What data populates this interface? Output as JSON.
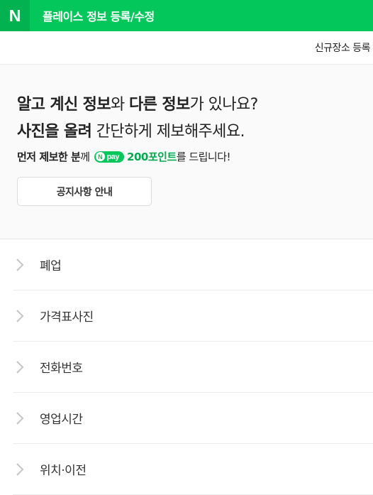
{
  "header": {
    "logo": "N",
    "title": "플레이스 정보 등록/수정"
  },
  "subbar": {
    "register_link": "신규장소 등록"
  },
  "promo": {
    "line1_bold1": "알고 계신 정보",
    "line1_text1": "와 ",
    "line1_bold2": "다른 정보",
    "line1_text2": "가 있나요?",
    "line2_bold": "사진을 올려",
    "line2_text": " 간단하게 제보해주세요.",
    "reward_bold1": "먼저 제보한 분",
    "reward_text1": "께",
    "npay_label": "pay",
    "npay_n": "N",
    "reward_points": "200포인트",
    "reward_text2": "를 드립니다!",
    "notice_button": "공지사항 안내"
  },
  "list": {
    "items": [
      {
        "label": "폐업"
      },
      {
        "label": "가격표사진"
      },
      {
        "label": "전화번호"
      },
      {
        "label": "영업시간"
      },
      {
        "label": "위치·이전"
      }
    ]
  },
  "colors": {
    "brand_green": "#03c75a",
    "points_green": "#03a94e"
  },
  "icons": {
    "list_chevron": "chevron-right-icon"
  }
}
